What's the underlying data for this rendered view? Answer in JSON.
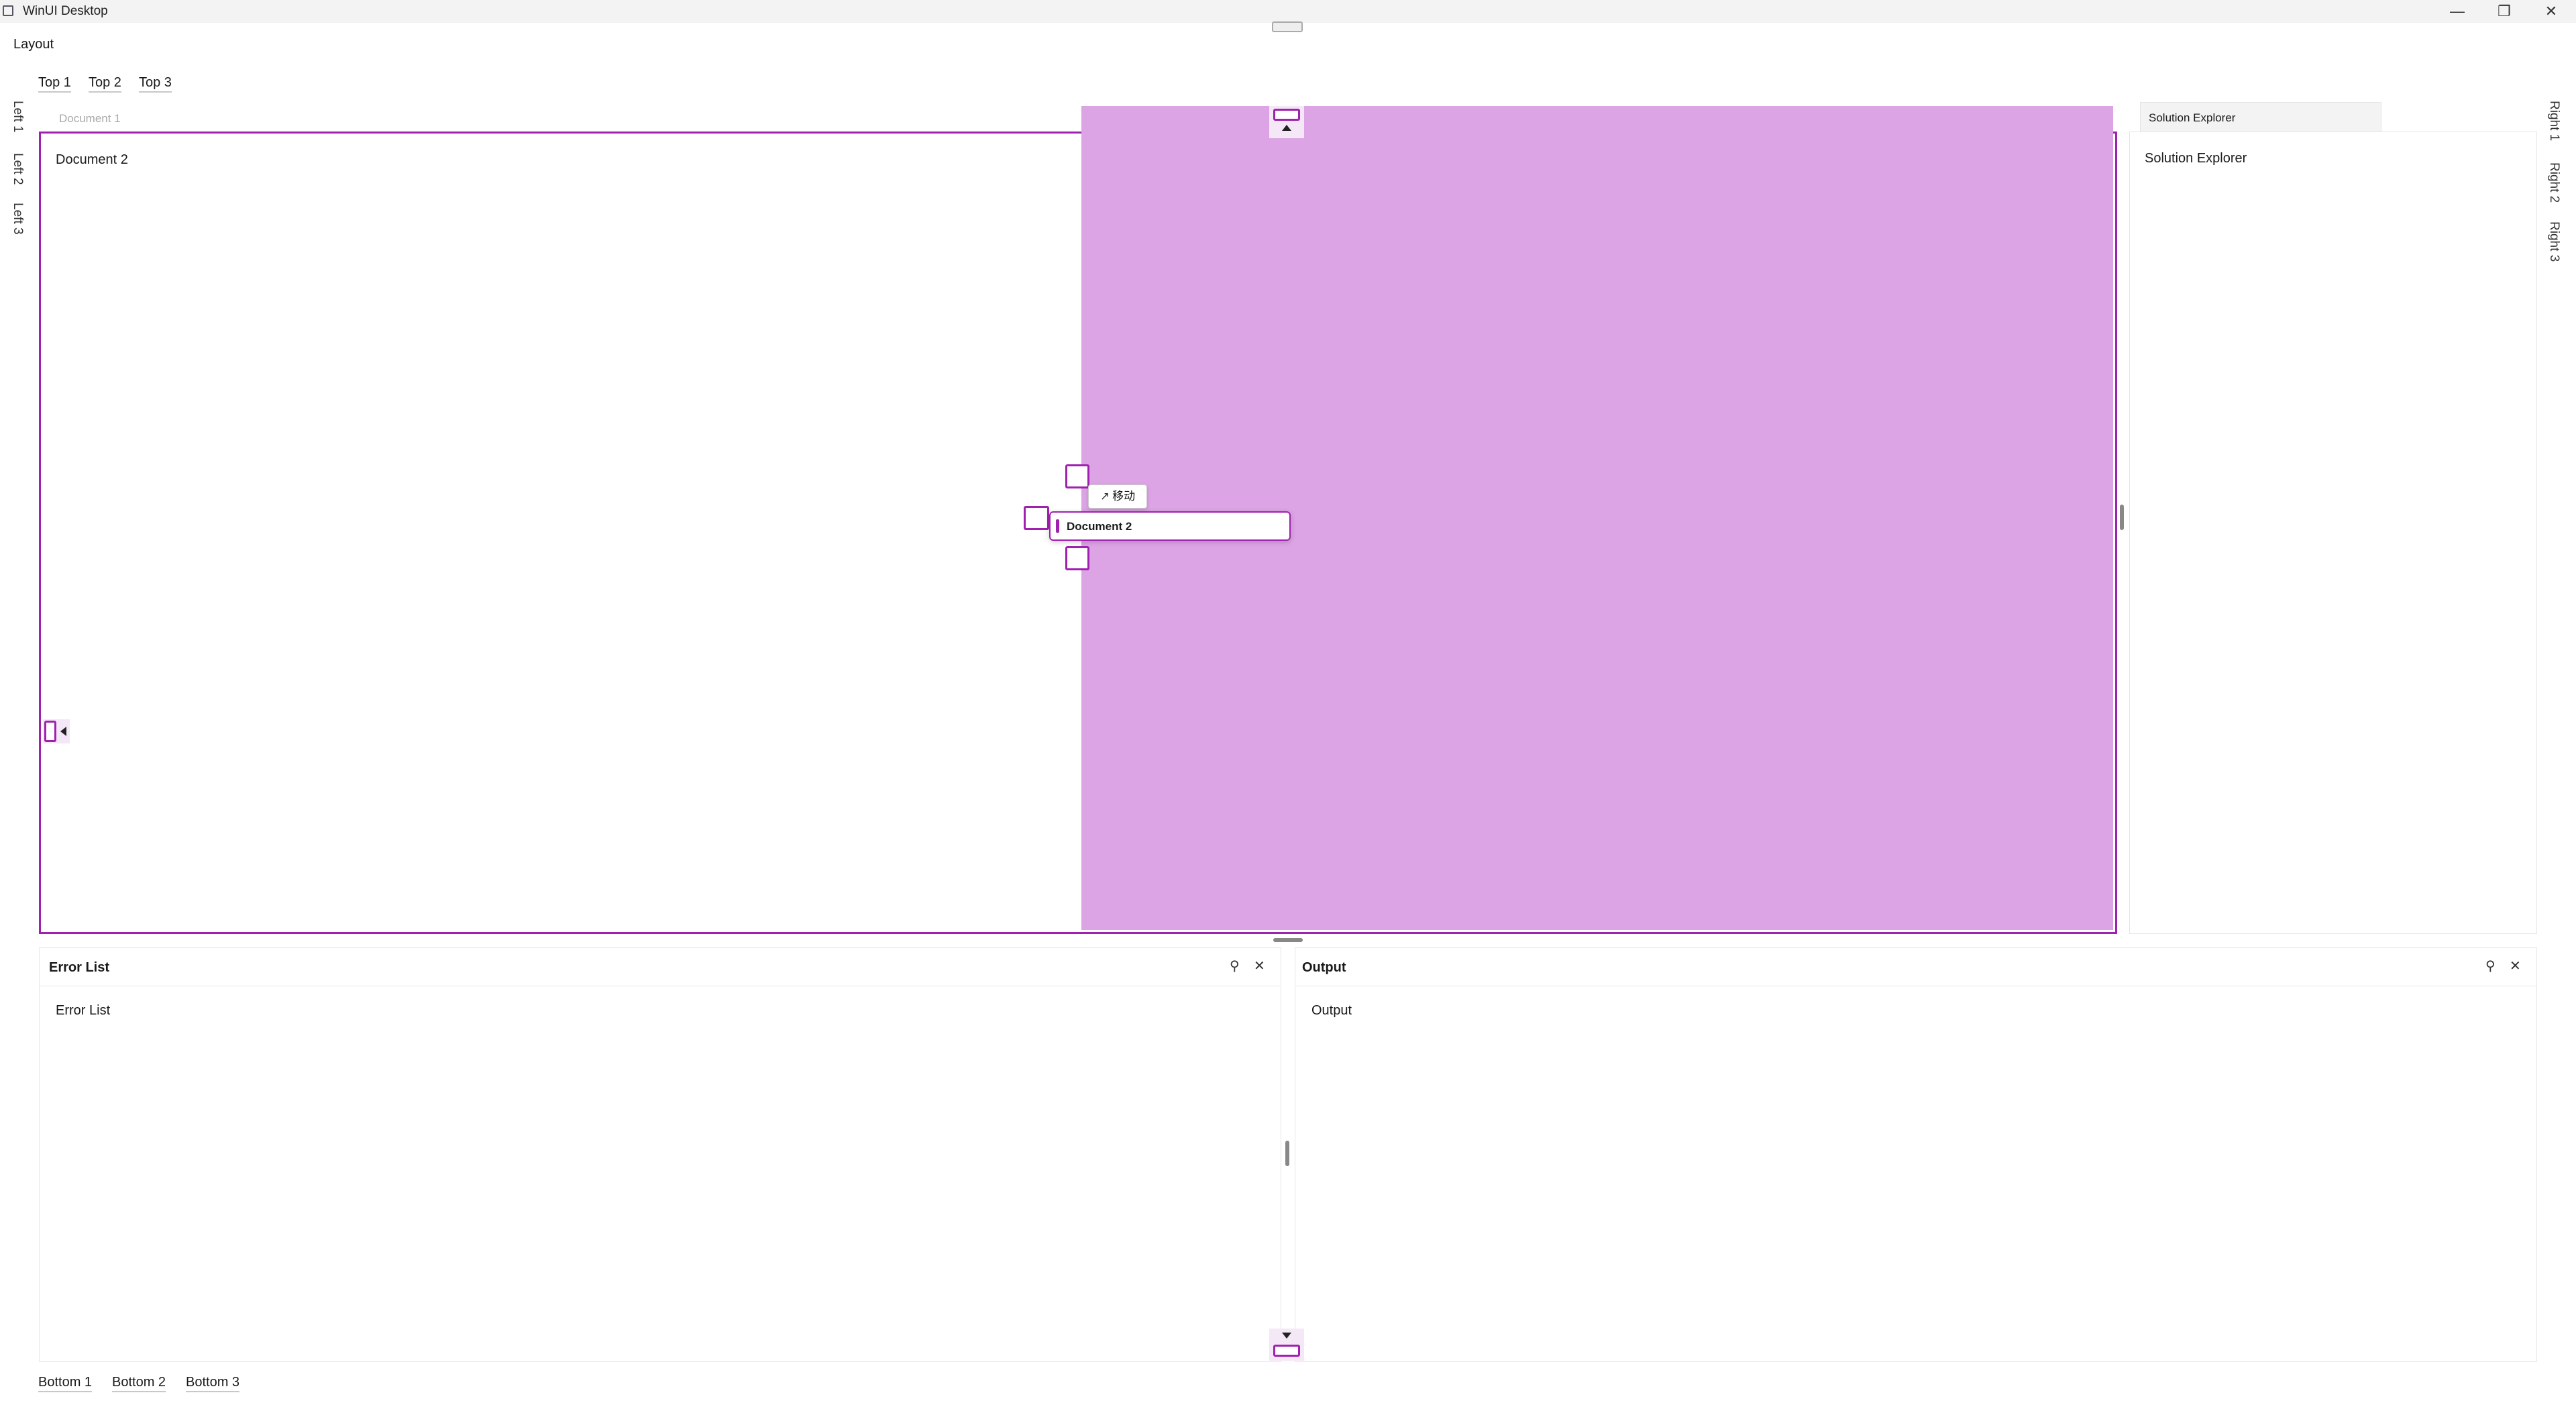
{
  "window": {
    "title": "WinUI Desktop"
  },
  "colors": {
    "accent": "#a020b0",
    "preview_fill": "#dca4e4",
    "titlebar": "#f3f3f3"
  },
  "menu": {
    "layout_label": "Layout"
  },
  "top_tabs": [
    "Top 1",
    "Top 2",
    "Top 3"
  ],
  "left_tabs": [
    "Left 1",
    "Left 2",
    "Left 3"
  ],
  "right_tabs": [
    "Right 1",
    "Right 2",
    "Right 3"
  ],
  "bottom_tabs": [
    "Bottom 1",
    "Bottom 2",
    "Bottom 3"
  ],
  "documents": {
    "inactive_tab": "Document 1",
    "active_content": "Document 2"
  },
  "solution_explorer": {
    "tab": "Solution Explorer",
    "content": "Solution Explorer"
  },
  "error_list": {
    "title": "Error List",
    "content": "Error List"
  },
  "output": {
    "title": "Output",
    "content": "Output"
  },
  "drag": {
    "tooltip": "移动",
    "tooltip_icon": "arrow-up-right-icon",
    "dragged_tab": "Document 2"
  },
  "icons": {
    "minimize": "—",
    "maximize": "❐",
    "close": "✕",
    "pin": "pin-icon"
  }
}
